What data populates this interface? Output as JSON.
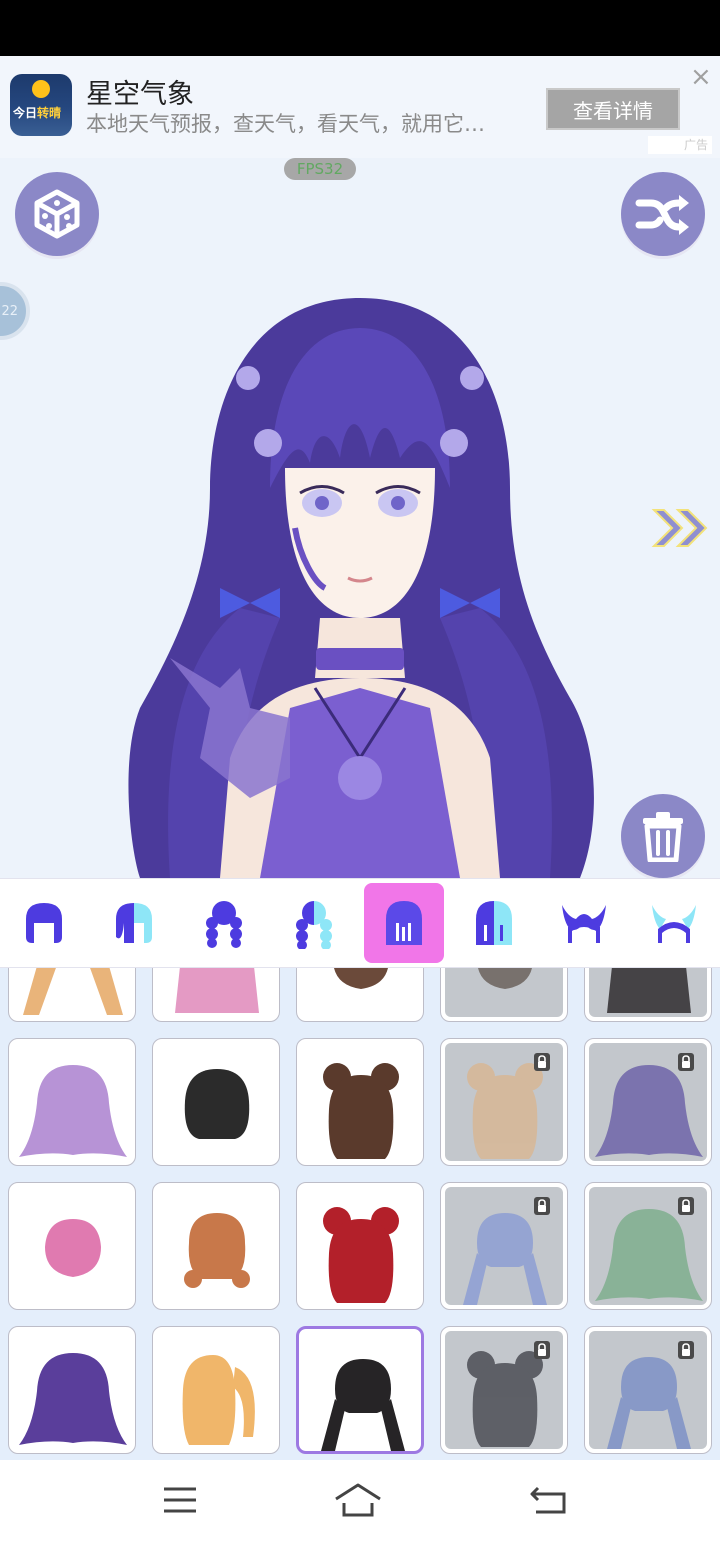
{
  "ad": {
    "logo_text": "今日",
    "logo_text_accent": "转晴",
    "title": "星空气象",
    "description": "本地天气预报，查天气，看天气，就用它…",
    "button_label": "查看详情",
    "close_glyph": "×",
    "ad_mark": "广告"
  },
  "stage": {
    "fps_label": "FPS32",
    "side_tab_label": "22",
    "icons": {
      "random": "dice-icon",
      "shuffle": "shuffle-icon",
      "next": "double-chevron-right-icon",
      "delete": "trash-icon"
    }
  },
  "categories": [
    {
      "name": "back-hair-1",
      "active": false
    },
    {
      "name": "back-hair-2",
      "active": false
    },
    {
      "name": "braid-hair-1",
      "active": false
    },
    {
      "name": "braid-hair-2",
      "active": false
    },
    {
      "name": "long-hair-1",
      "active": true
    },
    {
      "name": "long-hair-2",
      "active": false
    },
    {
      "name": "horn-accessory-1",
      "active": false
    },
    {
      "name": "horn-accessory-2",
      "active": false
    }
  ],
  "hair_items": [
    {
      "color": "#e9b47a",
      "style": "braids",
      "locked": false
    },
    {
      "color": "#e49ac4",
      "style": "long",
      "locked": false
    },
    {
      "color": "#6b4a3a",
      "style": "short",
      "locked": false
    },
    {
      "color": "#6b625c",
      "style": "short",
      "locked": true
    },
    {
      "color": "#2f2b2e",
      "style": "long",
      "locked": true
    },
    {
      "color": "#b793d6",
      "style": "wavy",
      "locked": false
    },
    {
      "color": "#2b2b2b",
      "style": "bob",
      "locked": false
    },
    {
      "color": "#5a3a2c",
      "style": "buns",
      "locked": false
    },
    {
      "color": "#d8b795",
      "style": "buns",
      "locked": true
    },
    {
      "color": "#6f64a8",
      "style": "wavy",
      "locked": true
    },
    {
      "color": "#e07ab0",
      "style": "short",
      "locked": false
    },
    {
      "color": "#c8784a",
      "style": "curly",
      "locked": false
    },
    {
      "color": "#b3202a",
      "style": "buns",
      "locked": false
    },
    {
      "color": "#8d9ed4",
      "style": "twintail",
      "locked": true
    },
    {
      "color": "#7fae8d",
      "style": "wavy",
      "locked": true
    },
    {
      "color": "#5a3e9b",
      "style": "wavy",
      "locked": false
    },
    {
      "color": "#f0b66a",
      "style": "ponytail",
      "locked": false
    },
    {
      "color": "#262426",
      "style": "twintail",
      "locked": false
    },
    {
      "color": "#4c4e55",
      "style": "buns",
      "locked": true
    },
    {
      "color": "#7e92c7",
      "style": "twintail",
      "locked": true
    }
  ],
  "selected_item": 17,
  "nav": {
    "menu": "menu-icon",
    "home": "home-icon",
    "back": "back-icon"
  }
}
